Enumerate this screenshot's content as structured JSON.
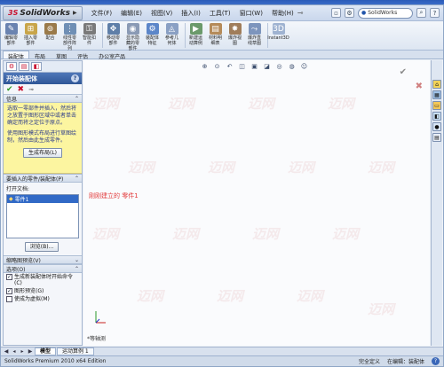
{
  "app": {
    "logo_text": "SolidWorks",
    "status_text": "SolidWorks Premium 2010 x64 Edition",
    "status_defined": "完全定义",
    "status_editing": "在编辑：装配体"
  },
  "menu": [
    "文件(F)",
    "编辑(E)",
    "视图(V)",
    "插入(I)",
    "工具(T)",
    "窗口(W)",
    "帮助(H)"
  ],
  "search": {
    "placeholder": "SolidWorks"
  },
  "ribbon": [
    {
      "label": "编辑零部件",
      "icon": "edit-component-icon",
      "color": "#6a83b0"
    },
    {
      "label": "插入零部件",
      "icon": "insert-component-icon",
      "color": "#c8a54a"
    },
    {
      "label": "配合",
      "icon": "mate-icon",
      "color": "#9a7a4a"
    },
    {
      "label": "线性零部件阵列",
      "icon": "linear-pattern-icon",
      "color": "#6f8fb5"
    },
    {
      "label": "智能扣件",
      "icon": "smart-fastener-icon",
      "color": "#7a7a7a"
    },
    {
      "label": "移动零部件",
      "icon": "move-component-icon",
      "color": "#5f7fa8"
    },
    {
      "label": "显示隐藏的零部件",
      "icon": "show-hidden-icon",
      "color": "#8a9ab5"
    },
    {
      "label": "装配体特征",
      "icon": "assembly-feature-icon",
      "color": "#5c86c9"
    },
    {
      "label": "参考几何体",
      "icon": "reference-geometry-icon",
      "color": "#8aa0c4"
    },
    {
      "label": "新建运动算例",
      "icon": "motion-study-icon",
      "color": "#6b9a6b"
    },
    {
      "label": "材料明细表",
      "icon": "bom-icon",
      "color": "#b58b5a"
    },
    {
      "label": "爆炸视图",
      "icon": "exploded-view-icon",
      "color": "#a07d5a"
    },
    {
      "label": "爆炸直线草图",
      "icon": "explode-line-icon",
      "color": "#7d95bd"
    },
    {
      "label": "Instant3D",
      "icon": "instant3d-icon",
      "color": "#9fb3d1"
    }
  ],
  "command_tabs": [
    "装配体",
    "布局",
    "草图",
    "评估",
    "办公室产品"
  ],
  "property_manager": {
    "title": "开始装配体",
    "help": "?",
    "message_header": "信息",
    "message_p1": "选取一零部件并插入，然后将之放置于图形区域中或者单击确定而将之定位于原点。",
    "message_p2": "使用图形模式布局进行草图绘制，然后由此生成零件。",
    "layout_button": "生成布局(L)",
    "insert_header": "要插入的零件/装配体(P)",
    "open_docs_label": "打开文档:",
    "part_item": "零件1",
    "browse_button": "浏览(B)...",
    "thumbnail_header": "缩略图预览(V)",
    "options_header": "选项(O)",
    "options": [
      {
        "label": "生成新装配体时开始命令(C)",
        "checked": true
      },
      {
        "label": "图形预览(G)",
        "checked": true
      },
      {
        "label": "使成为虚拟(M)",
        "checked": false
      }
    ]
  },
  "graphics": {
    "annotation": "刚刚建立的  零件1",
    "view_label": "*等轴测"
  },
  "model_tabs": [
    "模型",
    "运动算例 1"
  ]
}
